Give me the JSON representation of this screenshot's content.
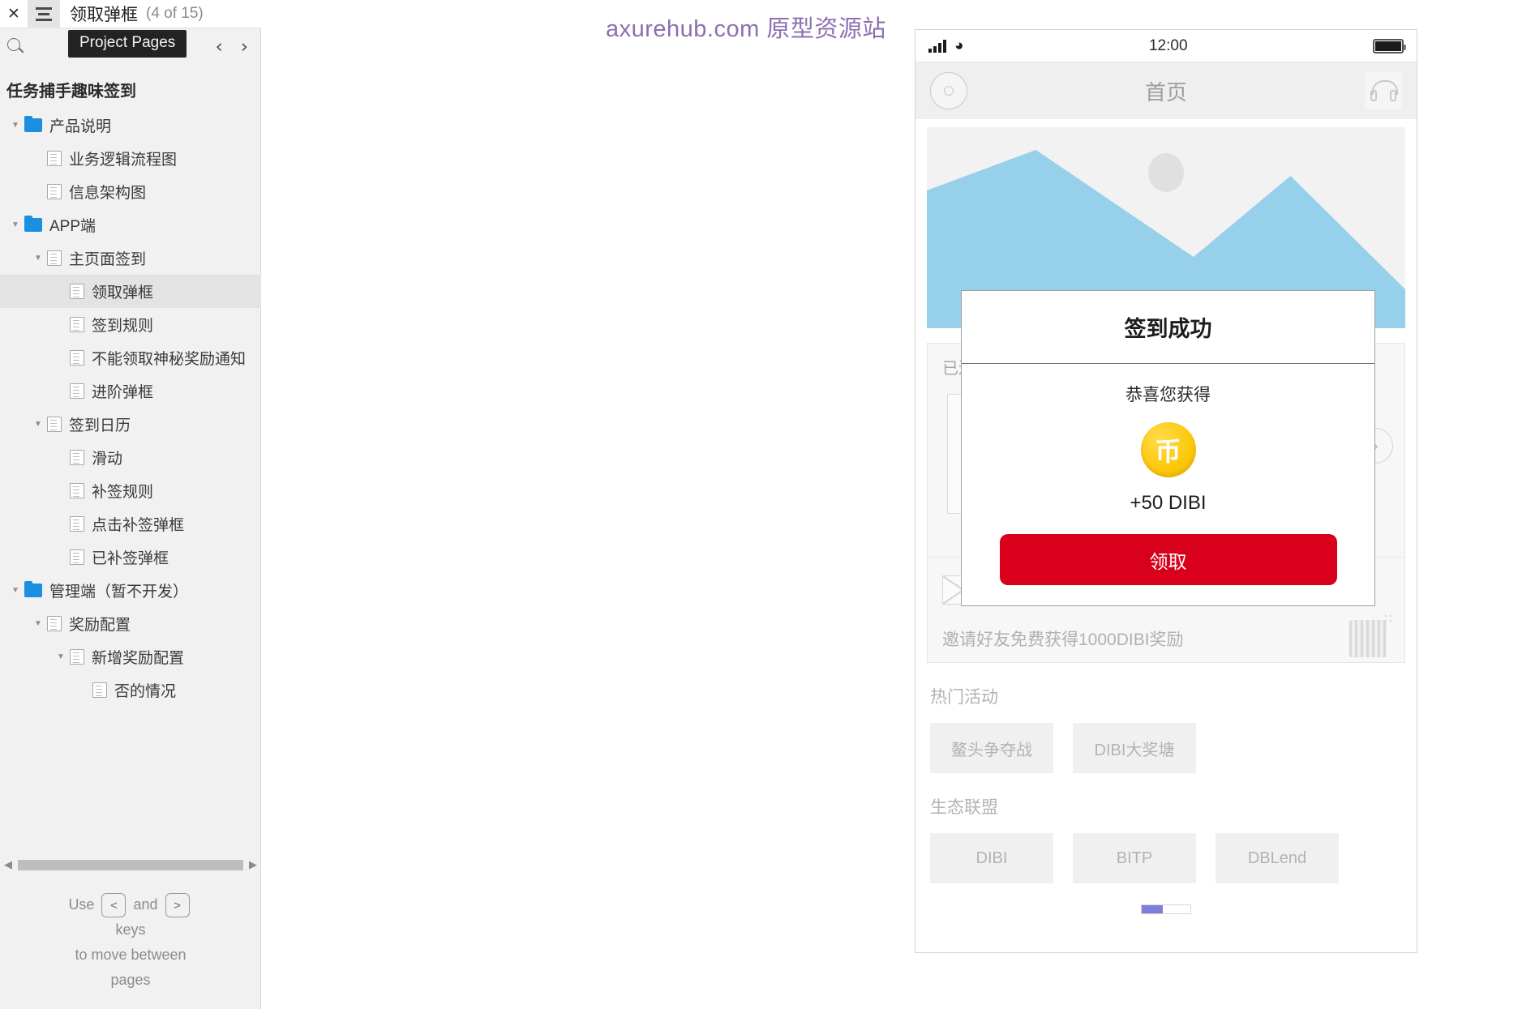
{
  "window": {
    "close_label": "✕",
    "menu_tooltip": "Project Pages",
    "page_title": "领取弹框",
    "page_count": "(4 of 15)",
    "prev_arrow": "‹",
    "next_arrow": "›"
  },
  "sidebar": {
    "project_name": "任务捕手趣味签到",
    "tree": [
      {
        "label": "产品说明",
        "type": "folder",
        "depth": 0,
        "caret": "▼",
        "selected": false
      },
      {
        "label": "业务逻辑流程图",
        "type": "page",
        "depth": 1,
        "caret": "",
        "selected": false
      },
      {
        "label": "信息架构图",
        "type": "page",
        "depth": 1,
        "caret": "",
        "selected": false
      },
      {
        "label": "APP端",
        "type": "folder",
        "depth": 0,
        "caret": "▼",
        "selected": false
      },
      {
        "label": "主页面签到",
        "type": "page",
        "depth": 1,
        "caret": "▼",
        "selected": false
      },
      {
        "label": "领取弹框",
        "type": "page",
        "depth": 2,
        "caret": "",
        "selected": true
      },
      {
        "label": "签到规则",
        "type": "page",
        "depth": 2,
        "caret": "",
        "selected": false
      },
      {
        "label": "不能领取神秘奖励通知",
        "type": "page",
        "depth": 2,
        "caret": "",
        "selected": false
      },
      {
        "label": "进阶弹框",
        "type": "page",
        "depth": 2,
        "caret": "",
        "selected": false
      },
      {
        "label": "签到日历",
        "type": "page",
        "depth": 1,
        "caret": "▼",
        "selected": false
      },
      {
        "label": "滑动",
        "type": "page",
        "depth": 2,
        "caret": "",
        "selected": false
      },
      {
        "label": "补签规则",
        "type": "page",
        "depth": 2,
        "caret": "",
        "selected": false
      },
      {
        "label": "点击补签弹框",
        "type": "page",
        "depth": 2,
        "caret": "",
        "selected": false
      },
      {
        "label": "已补签弹框",
        "type": "page",
        "depth": 2,
        "caret": "",
        "selected": false
      },
      {
        "label": "管理端（暂不开发）",
        "type": "folder",
        "depth": 0,
        "caret": "▼",
        "selected": false
      },
      {
        "label": "奖励配置",
        "type": "page",
        "depth": 1,
        "caret": "▼",
        "selected": false
      },
      {
        "label": "新增奖励配置",
        "type": "page",
        "depth": 2,
        "caret": "▼",
        "selected": false
      },
      {
        "label": "否的情况",
        "type": "page",
        "depth": 3,
        "caret": "",
        "selected": false
      }
    ],
    "hint": {
      "use": "Use",
      "key_prev": "<",
      "and": "and",
      "key_next": ">",
      "line2": "keys",
      "line3": "to move between",
      "line4": "pages"
    },
    "scroll_left_arrow": "◀",
    "scroll_right_arrow": "▶"
  },
  "canvas": {
    "watermark": "axurehub.com 原型资源站"
  },
  "phone": {
    "status": {
      "time": "12:00"
    },
    "nav": {
      "title": "首页"
    },
    "connect_card": {
      "label": "已连"
    },
    "invite": {
      "text": "邀请好友免费获得1000DIBI奖励"
    },
    "sections": [
      {
        "title": "热门活动",
        "tiles": [
          "鳌头争夺战",
          "DIBI大奖塘"
        ]
      },
      {
        "title": "生态联盟",
        "tiles": [
          "DIBI",
          "BITP",
          "DBLend"
        ]
      }
    ],
    "chevron": "›"
  },
  "modal": {
    "title": "签到成功",
    "subtitle": "恭喜您获得",
    "coin_glyph": "币",
    "amount": "+50 DIBI",
    "button_label": "领取",
    "button_color": "#d8001b"
  }
}
